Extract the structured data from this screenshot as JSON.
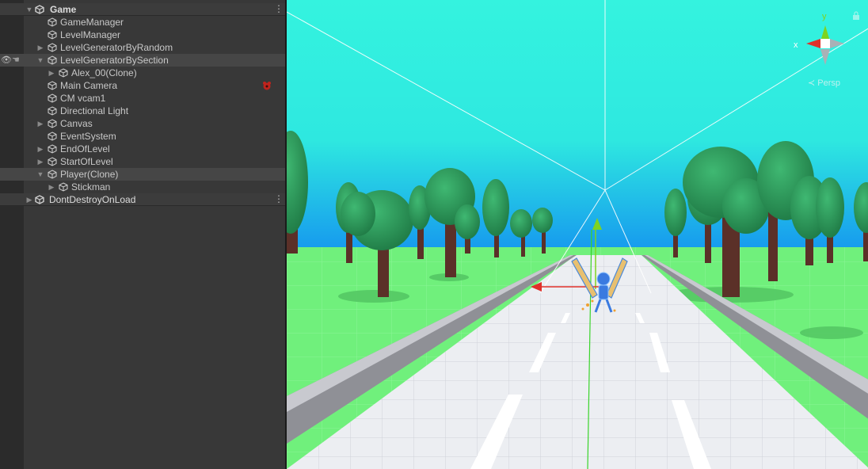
{
  "hierarchy": {
    "scene_name": "Game",
    "items": [
      {
        "label": "GameManager"
      },
      {
        "label": "LevelManager"
      },
      {
        "label": "LevelGeneratorByRandom"
      },
      {
        "label": "LevelGeneratorBySection"
      },
      {
        "label": "Alex_00(Clone)"
      },
      {
        "label": "Main Camera"
      },
      {
        "label": "CM vcam1"
      },
      {
        "label": "Directional Light"
      },
      {
        "label": "Canvas"
      },
      {
        "label": "EventSystem"
      },
      {
        "label": "EndOfLevel"
      },
      {
        "label": "StartOfLevel"
      },
      {
        "label": "Player(Clone)"
      },
      {
        "label": "Stickman"
      }
    ],
    "dont_destroy": "DontDestroyOnLoad"
  },
  "scene_view": {
    "projection_label": "Persp",
    "gizmo": {
      "x_label": "x",
      "y_label": "y"
    }
  },
  "colors": {
    "sky_top": "#34f3df",
    "sky_bottom": "#1a9ef0",
    "grass": "#6cf07a",
    "road": "#e8e9ee",
    "tree_foliage": "#2d9a5c",
    "tree_trunk": "#5b3028",
    "axis_x": "#e0302a",
    "axis_y": "#7ed321",
    "panel_bg": "#383838"
  }
}
